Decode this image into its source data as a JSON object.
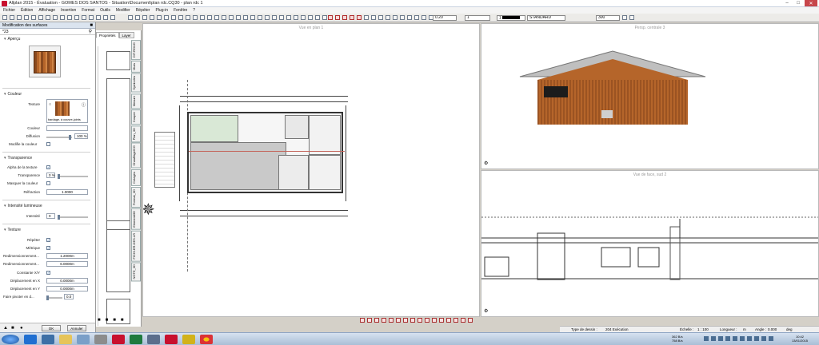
{
  "window": {
    "title": "Allplan 2015 - Évaluation - GOMES DOS SANTOS - Situation\\Document\\plan rdc.CQ30 - plan rdc 1"
  },
  "menu": [
    "Fichier",
    "Édition",
    "Affichage",
    "Insertion",
    "Format",
    "Outils",
    "Modifier",
    "Répéter",
    "Plug-in",
    "Fenêtre",
    "?"
  ],
  "toolbar": {
    "pen_value": "0.20",
    "line_value": "1",
    "color_value": "1",
    "layer_value": "STANDARD",
    "scale_value": "300"
  },
  "panel": {
    "title": "Modification des surfaces",
    "search": "*23",
    "sections": {
      "apercu": "Aperçu",
      "couleur": "Couleur",
      "transparence": "Transparence",
      "intensite": "Intensité lumineuse",
      "texture": "Texture"
    },
    "fields": {
      "texture_label": "Texture",
      "texture_name": "bardage, à couvre-joints",
      "couleur_label": "Couleur",
      "diffusion_label": "Diffusion",
      "diffusion_value": "100 %",
      "modifie_label": "Modifie la couleur",
      "alpha_label": "Alpha de la texture",
      "transparence_label": "Transparence",
      "transparence_value": "0 %",
      "masquer_label": "Masquer la couleur",
      "refraction_label": "Réfraction",
      "refraction_value": "1.0000",
      "intensite_label": "Intensité",
      "intensite_value": "0",
      "repeter_label": "Répéter",
      "metrique_label": "Métrique",
      "redim1_label": "Redimensionnement...",
      "redim1_value": "1.2000m",
      "redim2_label": "Redimensionnement...",
      "redim2_value": "6.0000m",
      "constante_label": "Constante X/Y",
      "depx_label": "Déplacement en X",
      "depx_value": "0.0000m",
      "depy_label": "Déplacement en Y",
      "depy_value": "0.0000m",
      "pivoter_label": "Faire pivoter en d...",
      "pivoter_value": "0.0"
    },
    "ok": "OK",
    "cancel": "Annuler"
  },
  "subpanel": {
    "tabs": [
      "Propriétés",
      "Layer"
    ],
    "side_tabs": [
      "DIT.ROUG",
      "Murs",
      "Symboles",
      "Mesure",
      "Couper",
      "Plan_3D",
      "Chauffage/CG",
      "Cotages",
      "Format_3D",
      "Elementi3D",
      "FICHI.ER.DES.LR",
      "NOTE_3D"
    ]
  },
  "plan_text": {
    "big_text_1": "PL",
    "big_text_2": "LA"
  },
  "panes": {
    "plan": "Vue en plan 1",
    "perspective": "Persp. centrale 3",
    "facade": "Vue de face, sud 2"
  },
  "statusbar": {
    "type_label": "Type de dessin :",
    "type_value": "204 Exécution",
    "echelle_label": "Échelle :",
    "echelle_value": "1 : 100",
    "longueur_label": "Longueur :",
    "longueur_value": "m",
    "angle_label": "Angle :",
    "angle_value": "0.000",
    "unit": "deg"
  },
  "taskbar": {
    "net_up": "362 B/s",
    "net_down": "758 B/s",
    "time": "10:42",
    "date": "13/01/2015"
  },
  "colors": {
    "accent": "#c8102e",
    "wood": "#b5652a",
    "wall": "#c4655b"
  }
}
